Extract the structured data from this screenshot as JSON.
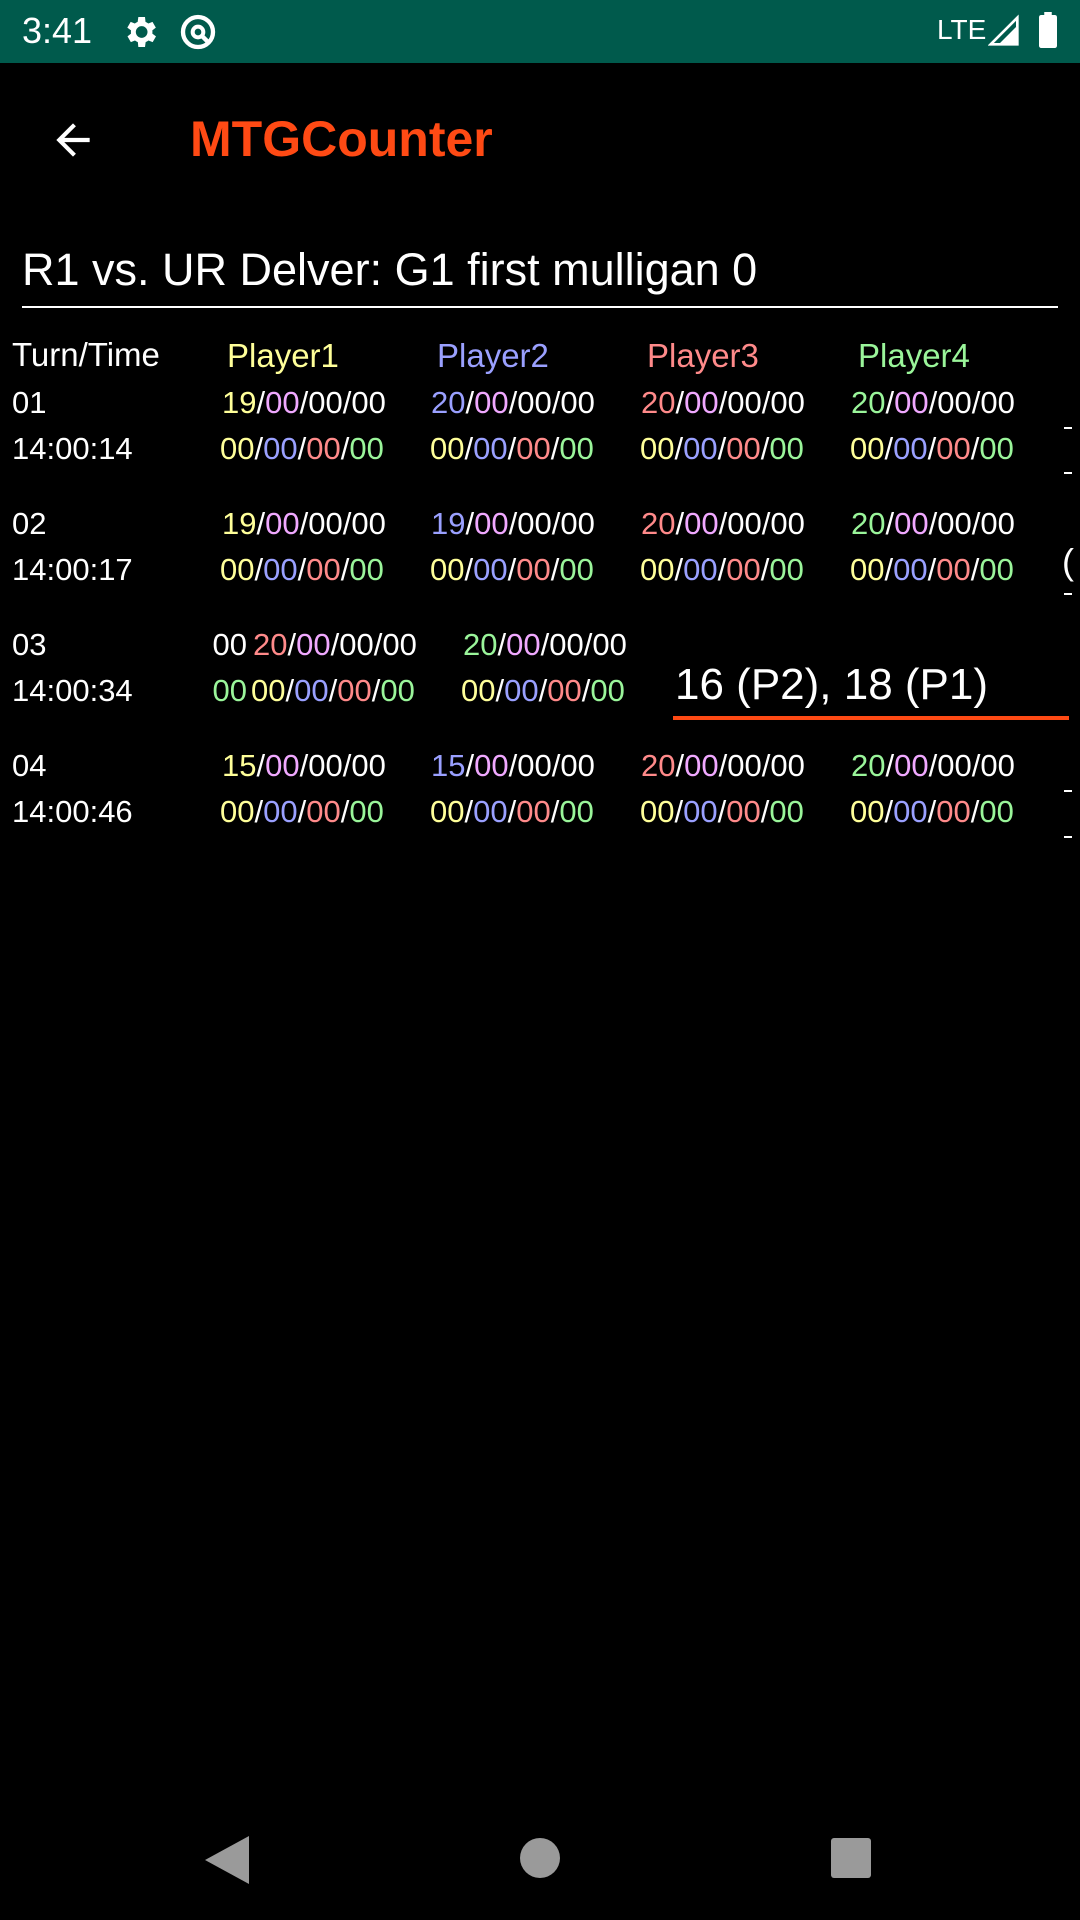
{
  "status_bar": {
    "time": "3:41",
    "network": "LTE",
    "icons": [
      "gear-icon",
      "circle-slash-icon",
      "signal-icon",
      "battery-icon"
    ]
  },
  "app_bar": {
    "title": "MTGCounter",
    "back_icon": "arrow-left-icon"
  },
  "game": {
    "name": "R1 vs. UR Delver: G1 first mulligan 0"
  },
  "table": {
    "header": {
      "turn_time": "Turn/Time",
      "players": [
        "Player1",
        "Player2",
        "Player3",
        "Player4"
      ]
    },
    "rows": [
      {
        "turn": "01",
        "time": "14:00:14",
        "players": [
          {
            "life": "19",
            "poison": "00",
            "a": "00",
            "b": "00",
            "m1": "00",
            "m2": "00",
            "m3": "00",
            "m4": "00"
          },
          {
            "life": "20",
            "poison": "00",
            "a": "00",
            "b": "00",
            "m1": "00",
            "m2": "00",
            "m3": "00",
            "m4": "00"
          },
          {
            "life": "20",
            "poison": "00",
            "a": "00",
            "b": "00",
            "m1": "00",
            "m2": "00",
            "m3": "00",
            "m4": "00"
          },
          {
            "life": "20",
            "poison": "00",
            "a": "00",
            "b": "00",
            "m1": "00",
            "m2": "00",
            "m3": "00",
            "m4": "00"
          }
        ]
      },
      {
        "turn": "02",
        "time": "14:00:17",
        "players": [
          {
            "life": "19",
            "poison": "00",
            "a": "00",
            "b": "00",
            "m1": "00",
            "m2": "00",
            "m3": "00",
            "m4": "00"
          },
          {
            "life": "19",
            "poison": "00",
            "a": "00",
            "b": "00",
            "m1": "00",
            "m2": "00",
            "m3": "00",
            "m4": "00"
          },
          {
            "life": "20",
            "poison": "00",
            "a": "00",
            "b": "00",
            "m1": "00",
            "m2": "00",
            "m3": "00",
            "m4": "00"
          },
          {
            "life": "20",
            "poison": "00",
            "a": "00",
            "b": "00",
            "m1": "00",
            "m2": "00",
            "m3": "00",
            "m4": "00"
          }
        ]
      },
      {
        "turn": "03",
        "time": "14:00:34",
        "partial_left_top": "00",
        "partial_left_bottom": "00",
        "players": [
          {
            "life": "20",
            "poison": "00",
            "a": "00",
            "b": "00",
            "m1": "00",
            "m2": "00",
            "m3": "00",
            "m4": "00"
          },
          {
            "life": "20",
            "poison": "00",
            "a": "00",
            "b": "00",
            "m1": "00",
            "m2": "00",
            "m3": "00",
            "m4": "00"
          }
        ],
        "note": "16 (P2), 18 (P1)"
      },
      {
        "turn": "04",
        "time": "14:00:46",
        "players": [
          {
            "life": "15",
            "poison": "00",
            "a": "00",
            "b": "00",
            "m1": "00",
            "m2": "00",
            "m3": "00",
            "m4": "00"
          },
          {
            "life": "15",
            "poison": "00",
            "a": "00",
            "b": "00",
            "m1": "00",
            "m2": "00",
            "m3": "00",
            "m4": "00"
          },
          {
            "life": "20",
            "poison": "00",
            "a": "00",
            "b": "00",
            "m1": "00",
            "m2": "00",
            "m3": "00",
            "m4": "00"
          },
          {
            "life": "20",
            "poison": "00",
            "a": "00",
            "b": "00",
            "m1": "00",
            "m2": "00",
            "m3": "00",
            "m4": "00"
          }
        ]
      }
    ],
    "edge_glyph": "("
  },
  "colors": {
    "accent": "#ff4a14",
    "status_bar": "#005a4c",
    "player1": "#ffff99",
    "player2": "#9aa0ff",
    "player3": "#ff8a8a",
    "player4": "#9af59a",
    "poison": "#f0a8ff"
  },
  "nav_bar": {
    "icons": [
      "triangle-back-icon",
      "circle-home-icon",
      "square-recents-icon"
    ]
  }
}
